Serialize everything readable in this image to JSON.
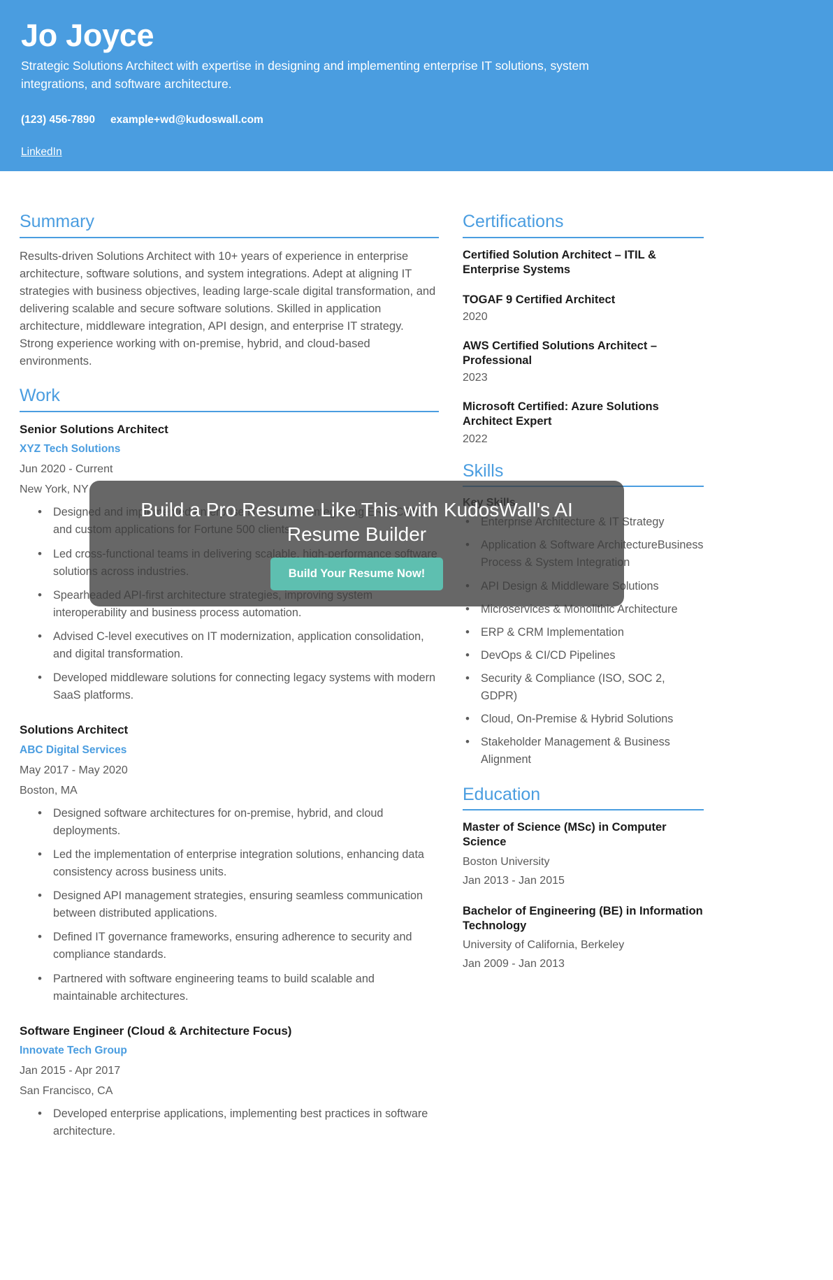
{
  "theme": {
    "accent": "#4a9de0",
    "overlay_bg": "rgba(60,60,60,0.78)",
    "button_bg": "#5ebfb0",
    "heading_text": "#1b1b1b",
    "body_text": "#5a5a5a"
  },
  "header": {
    "name": "Jo Joyce",
    "tagline": "Strategic Solutions Architect with expertise in designing and implementing enterprise IT solutions, system integrations, and software architecture.",
    "phone": "(123) 456-7890",
    "email": "example+wd@kudoswall.com",
    "link_label": "LinkedIn"
  },
  "summary": {
    "title": "Summary",
    "text": "Results-driven Solutions Architect with 10+ years of experience in enterprise architecture, software solutions, and system integrations. Adept at aligning IT strategies with business objectives, leading large-scale digital transformation, and delivering scalable and secure software solutions. Skilled in application architecture, middleware integration, API design, and enterprise IT strategy. Strong experience working with on-premise, hybrid, and cloud-based environments."
  },
  "work": {
    "title": "Work",
    "jobs": [
      {
        "title": "Senior Solutions Architect",
        "company": "XYZ Tech Solutions",
        "dates": "Jun 2020 - Current",
        "location": "New York, NY",
        "bullets": [
          "Designed and implemented enterprise IT solutions, integrating ERP, CRM, and custom applications for Fortune 500 clients.",
          "Led cross-functional teams in delivering scalable, high-performance software solutions across industries.",
          "Spearheaded API-first architecture strategies, improving system interoperability and business process automation.",
          "Advised C-level executives on IT modernization, application consolidation, and digital transformation.",
          "Developed middleware solutions for connecting legacy systems with modern SaaS platforms."
        ]
      },
      {
        "title": "Solutions Architect",
        "company": "ABC Digital Services",
        "dates": "May 2017 - May 2020",
        "location": "Boston, MA",
        "bullets": [
          "Designed software architectures for on-premise, hybrid, and cloud deployments.",
          "Led the implementation of enterprise integration solutions, enhancing data consistency across business units.",
          "Designed API management strategies, ensuring seamless communication between distributed applications.",
          "Defined IT governance frameworks, ensuring adherence to security and compliance standards.",
          "Partnered with software engineering teams to build scalable and maintainable architectures."
        ]
      },
      {
        "title": "Software Engineer (Cloud & Architecture Focus)",
        "company": "Innovate Tech Group",
        "dates": "Jan 2015 - Apr 2017",
        "location": "San Francisco, CA",
        "bullets": [
          "Developed enterprise applications, implementing best practices in software architecture."
        ]
      }
    ]
  },
  "certifications": {
    "title": "Certifications",
    "items": [
      {
        "name": "Certified Solution Architect – ITIL & Enterprise Systems",
        "year": ""
      },
      {
        "name": "TOGAF 9 Certified Architect",
        "year": "2020"
      },
      {
        "name": "AWS Certified Solutions Architect – Professional",
        "year": "2023"
      },
      {
        "name": "Microsoft Certified: Azure Solutions Architect Expert",
        "year": "2022"
      }
    ]
  },
  "skills": {
    "title": "Skills",
    "group_title": "Key Skills",
    "items": [
      "Enterprise Architecture & IT Strategy",
      "Application & Software ArchitectureBusiness Process & System Integration",
      "API Design & Middleware Solutions",
      "Microservices & Monolithic Architecture",
      "ERP & CRM Implementation",
      "DevOps & CI/CD Pipelines",
      "Security & Compliance (ISO, SOC 2, GDPR)",
      "Cloud, On-Premise & Hybrid Solutions",
      "Stakeholder Management & Business Alignment"
    ]
  },
  "education": {
    "title": "Education",
    "items": [
      {
        "degree": "Master of Science (MSc) in Computer Science",
        "school": "Boston University",
        "dates": "Jan 2013 - Jan 2015"
      },
      {
        "degree": "Bachelor of Engineering (BE) in Information Technology",
        "school": "University of California, Berkeley",
        "dates": "Jan 2009 - Jan 2013"
      }
    ]
  },
  "promo": {
    "heading": "Build a Pro Resume Like This with KudosWall's AI Resume Builder",
    "button_label": "Build Your Resume Now!"
  }
}
